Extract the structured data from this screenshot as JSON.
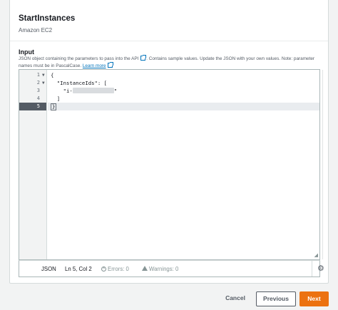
{
  "header": {
    "title": "StartInstances",
    "subtitle": "Amazon EC2"
  },
  "input": {
    "label": "Input",
    "description_part1": "JSON object containing the parameters to pass into the API",
    "description_part2": ". Contains sample values. Update the JSON with your own values. Note: parameter names must be in PascalCase.",
    "learn_more": "Learn more"
  },
  "editor": {
    "lines": [
      {
        "number": "1",
        "text": "{",
        "foldable": true
      },
      {
        "number": "2",
        "text": "  \"InstanceIds\": [",
        "foldable": true
      },
      {
        "number": "3",
        "text_prefix": "    \"i-",
        "text_suffix": "\"",
        "redacted": true,
        "foldable": false
      },
      {
        "number": "4",
        "text": "  ]",
        "foldable": false
      },
      {
        "number": "5",
        "text": "}",
        "foldable": false,
        "active": true
      }
    ],
    "fold_glyph": "▼"
  },
  "status_bar": {
    "language": "JSON",
    "position": "Ln 5, Col 2",
    "errors": "Errors: 0",
    "warnings": "Warnings: 0"
  },
  "footer": {
    "cancel_label": "Cancel",
    "previous_label": "Previous",
    "next_label": "Next"
  },
  "colors": {
    "primary_button": "#ec7211",
    "link": "#0073bb"
  }
}
